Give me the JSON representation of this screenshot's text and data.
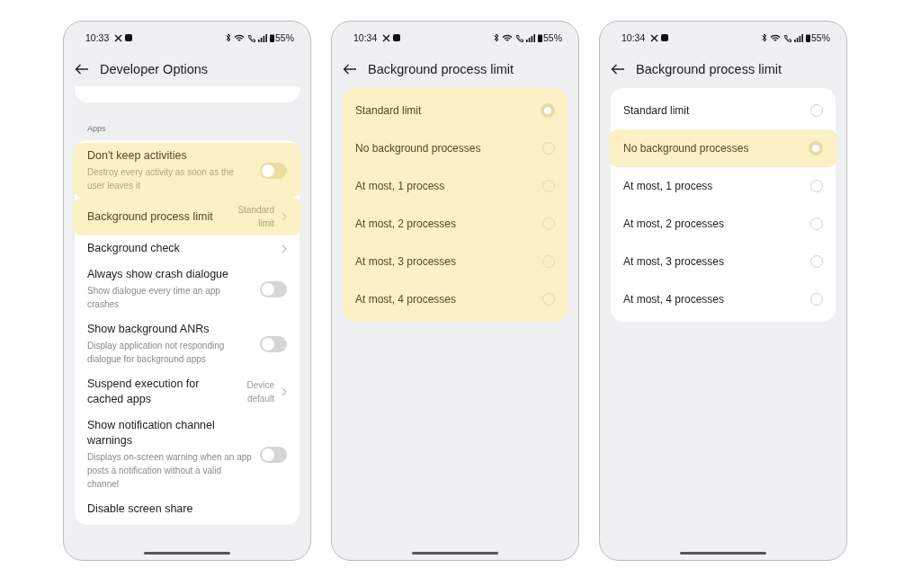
{
  "phones": [
    {
      "status_bar": {
        "time": "10:33",
        "battery": "55%"
      },
      "header": {
        "title": "Developer Options"
      },
      "screen": {
        "kind": "settings",
        "section_label": "Apps",
        "rows": [
          {
            "kind": "toggle",
            "title": "Don't keep activities",
            "subtitle": "Destroy every activity as soon as the user leaves it",
            "on": false,
            "highlighted": true
          },
          {
            "kind": "link",
            "title": "Background process limit",
            "value": "Standard limit",
            "highlighted": true
          },
          {
            "kind": "link",
            "title": "Background check",
            "highlighted": false
          },
          {
            "kind": "toggle",
            "title": "Always show crash dialogue",
            "subtitle": "Show dialogue every time an app crashes",
            "on": false,
            "highlighted": false
          },
          {
            "kind": "toggle",
            "title": "Show background ANRs",
            "subtitle": "Display application not responding dialogue for background apps",
            "on": false,
            "highlighted": false
          },
          {
            "kind": "link",
            "title": "Suspend execution for cached apps",
            "value": "Device default",
            "highlighted": false
          },
          {
            "kind": "toggle",
            "title": "Show notification channel warnings",
            "subtitle": "Displays on-screen warning when an app posts a notification without a valid channel",
            "on": false,
            "highlighted": false
          },
          {
            "kind": "plain",
            "title": "Disable screen share",
            "highlighted": false
          }
        ]
      }
    },
    {
      "status_bar": {
        "time": "10:34",
        "battery": "55%"
      },
      "header": {
        "title": "Background process limit"
      },
      "screen": {
        "kind": "radio_list",
        "highlighted": true,
        "options": [
          {
            "label": "Standard limit",
            "selected": true,
            "highlighted": false
          },
          {
            "label": "No background processes",
            "selected": false,
            "highlighted": false
          },
          {
            "label": "At most, 1 process",
            "selected": false,
            "highlighted": false
          },
          {
            "label": "At most, 2 processes",
            "selected": false,
            "highlighted": false
          },
          {
            "label": "At most, 3 processes",
            "selected": false,
            "highlighted": false
          },
          {
            "label": "At most, 4 processes",
            "selected": false,
            "highlighted": false
          }
        ]
      }
    },
    {
      "status_bar": {
        "time": "10:34",
        "battery": "55%"
      },
      "header": {
        "title": "Background process limit"
      },
      "screen": {
        "kind": "radio_list",
        "highlighted": false,
        "options": [
          {
            "label": "Standard limit",
            "selected": false,
            "highlighted": false
          },
          {
            "label": "No background processes",
            "selected": true,
            "highlighted": true
          },
          {
            "label": "At most, 1 process",
            "selected": false,
            "highlighted": false
          },
          {
            "label": "At most, 2 processes",
            "selected": false,
            "highlighted": false
          },
          {
            "label": "At most, 3 processes",
            "selected": false,
            "highlighted": false
          },
          {
            "label": "At most, 4 processes",
            "selected": false,
            "highlighted": false
          }
        ]
      }
    }
  ]
}
